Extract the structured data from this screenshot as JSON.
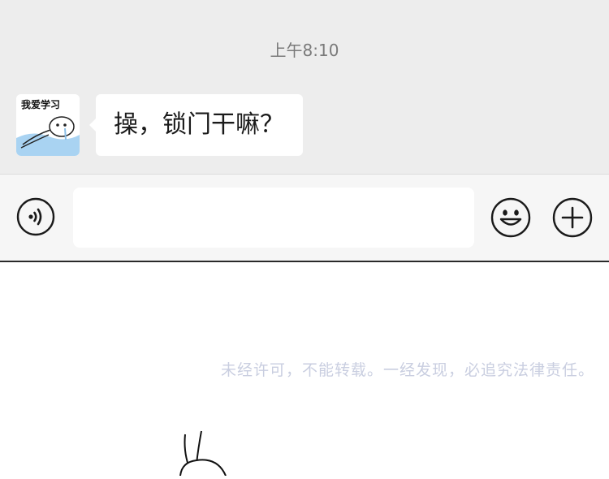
{
  "chat": {
    "timestamp": "上午8:10",
    "messages": [
      {
        "avatar_text": "我爱学习",
        "text": "操，锁门干嘛？"
      }
    ]
  },
  "input_bar": {
    "voice_icon": "voice-wave-icon",
    "emoji_icon": "smiley-icon",
    "plus_icon": "plus-icon",
    "text_value": ""
  },
  "watermark": "未经许可，不能转载。一经发现，必追究法律责任。"
}
